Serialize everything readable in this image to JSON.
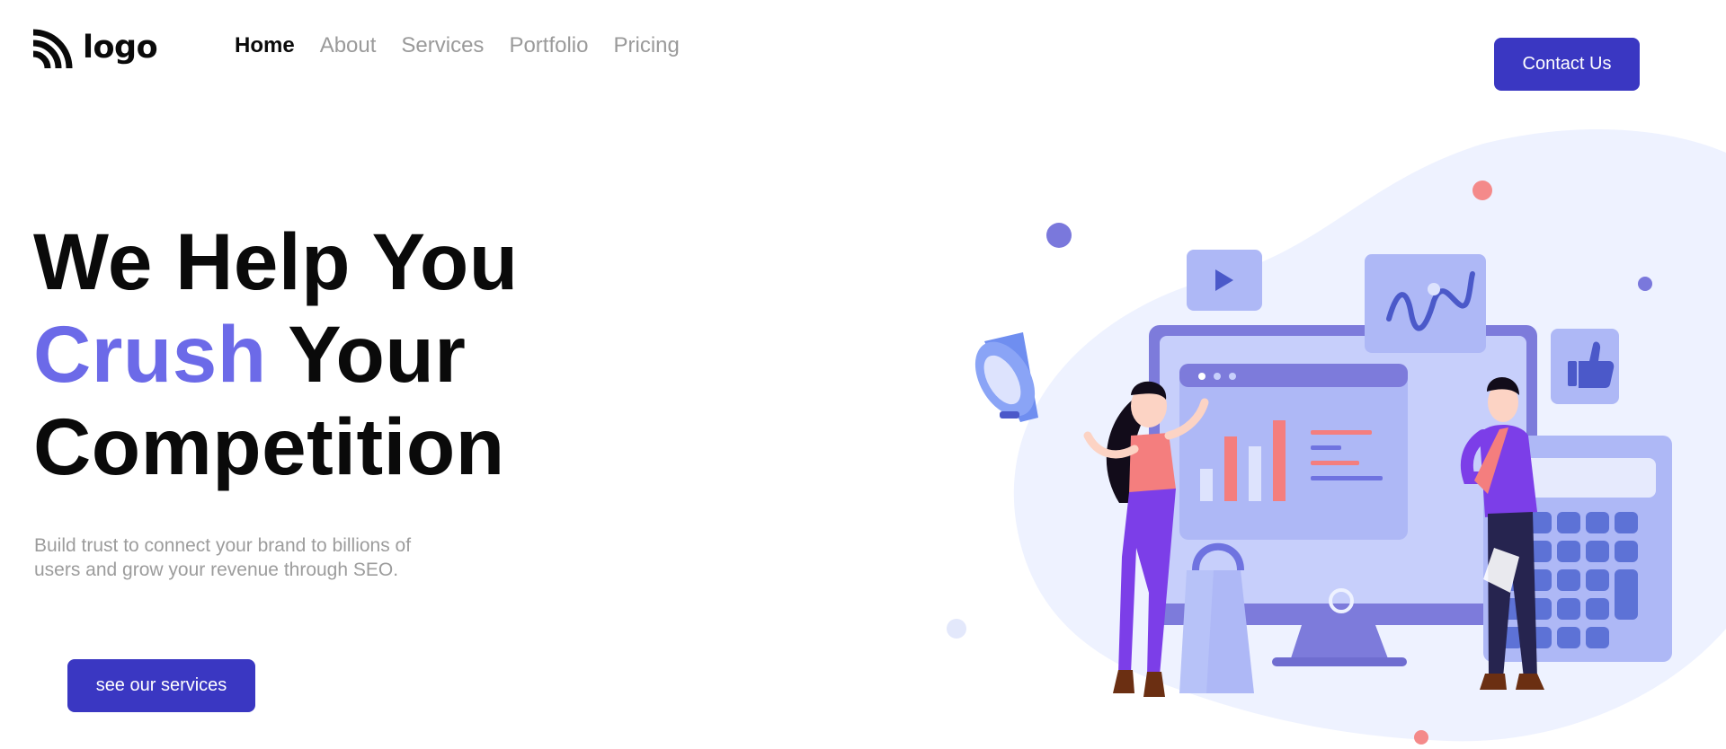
{
  "header": {
    "logo_text": "logo",
    "logo_icon": "rss-waves-icon",
    "nav": [
      {
        "label": "Home",
        "active": true
      },
      {
        "label": "About",
        "active": false
      },
      {
        "label": "Services",
        "active": false
      },
      {
        "label": "Portfolio",
        "active": false
      },
      {
        "label": "Pricing",
        "active": false
      }
    ],
    "contact_label": "Contact Us"
  },
  "hero": {
    "title_line1": "We Help You",
    "title_accent": "Crush",
    "title_line2_rest": " Your",
    "title_line3": "Competition",
    "subtitle_line1": "Build trust to connect your brand to billions of",
    "subtitle_line2": "users and grow your revenue through SEO.",
    "cta_label": "see our services"
  },
  "illustration": {
    "description_icons": [
      "megaphone-icon",
      "play-icon",
      "wave-chart-icon",
      "thumbs-up-icon",
      "calculator-icon",
      "shopping-bag-icon",
      "monitor-icon"
    ]
  },
  "colors": {
    "brand": "#3a37c2",
    "accent": "#6c6ae8",
    "muted_text": "#9a9a9a"
  }
}
